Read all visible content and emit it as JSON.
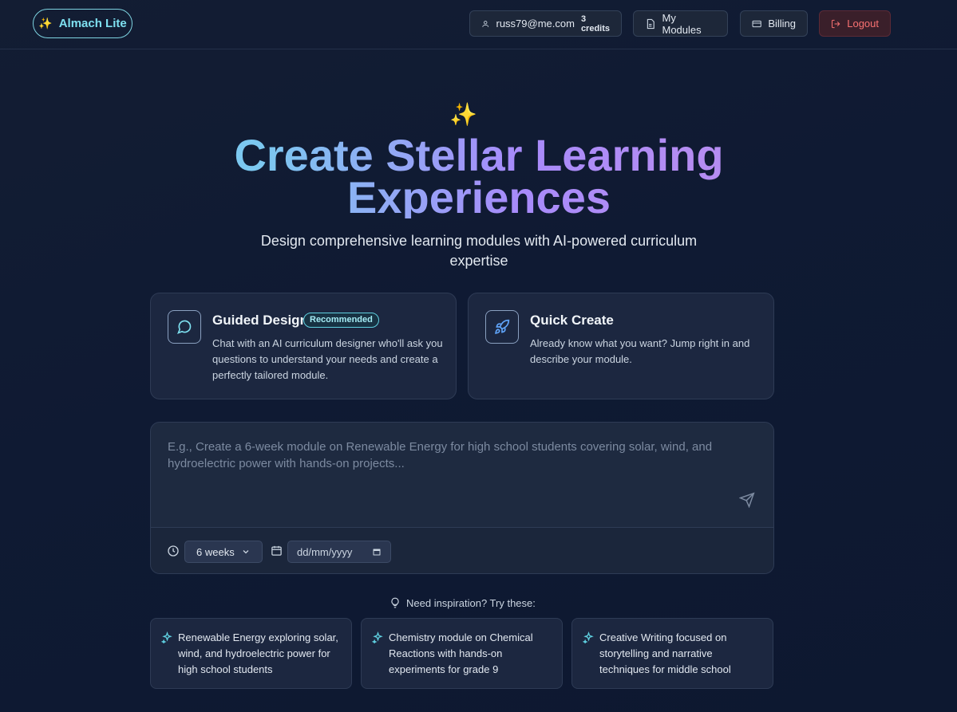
{
  "header": {
    "brand_spark": "✨",
    "brand_name": "Almach Lite",
    "user_email": "russ79@me.com",
    "credits": "3 credits",
    "my_modules_label": "My Modules",
    "billing_label": "Billing",
    "logout_label": "Logout"
  },
  "hero": {
    "spark": "✨",
    "title": "Create Stellar Learning Experiences",
    "subtitle": "Design comprehensive learning modules with AI-powered curriculum expertise"
  },
  "modes": {
    "guided": {
      "title": "Guided Design",
      "badge": "Recommended",
      "description": "Chat with an AI curriculum designer who'll ask you questions to understand your needs and create a perfectly tailored module.",
      "icon": "chat-bubble-icon"
    },
    "quick": {
      "title": "Quick Create",
      "description": "Already know what you want? Jump right in and describe your module.",
      "icon": "rocket-icon"
    }
  },
  "prompt": {
    "value": "",
    "placeholder": "E.g., Create a 6-week module on Renewable Energy for high school students covering solar, wind, and hydroelectric power with hands-on projects...",
    "duration": "6 weeks",
    "date_placeholder": "dd/mm/yyyy"
  },
  "inspiration": {
    "label": "Need inspiration? Try these:",
    "suggestions": [
      "Renewable Energy exploring solar, wind, and hydroelectric power for high school students",
      "Chemistry module on Chemical Reactions with hands-on experiments for grade 9",
      "Creative Writing focused on storytelling and narrative techniques for middle school"
    ]
  },
  "colors": {
    "accent_cyan": "#7ee0f0",
    "accent_purple": "#a78bfa",
    "logout_red": "#f87171"
  }
}
